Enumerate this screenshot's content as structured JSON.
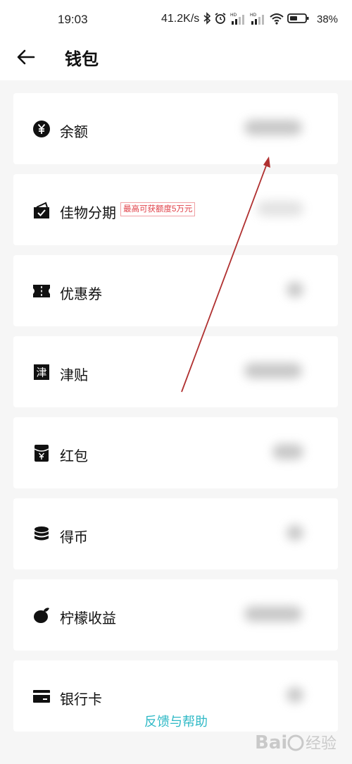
{
  "status_bar": {
    "time": "19:03",
    "net_speed": "41.2K/s",
    "battery_pct": "38%",
    "icons": [
      "bluetooth-icon",
      "alarm-icon",
      "signal-hd-icon",
      "signal-hd-icon",
      "wifi-icon",
      "battery-icon"
    ]
  },
  "header": {
    "title": "钱包",
    "back_icon": "back-arrow-icon"
  },
  "wallet_items": [
    {
      "label": "余额",
      "icon": "yen-coin-icon"
    },
    {
      "label": "佳物分期",
      "icon": "bag-check-icon",
      "tag": "最高可获额度5万元"
    },
    {
      "label": "优惠券",
      "icon": "ticket-icon"
    },
    {
      "label": "津贴",
      "icon": "allowance-icon",
      "icon_char": "津"
    },
    {
      "label": "红包",
      "icon": "red-packet-icon"
    },
    {
      "label": "得币",
      "icon": "coin-stack-icon"
    },
    {
      "label": "柠檬收益",
      "icon": "lemon-icon"
    },
    {
      "label": "银行卡",
      "icon": "bank-card-icon"
    }
  ],
  "footer": {
    "help_link": "反馈与帮助"
  },
  "colors": {
    "accent": "#2fb9c6",
    "tag_red": "#e0424a",
    "annotation_arrow": "#b03030"
  },
  "watermark": {
    "text": "Baidu 经验"
  }
}
